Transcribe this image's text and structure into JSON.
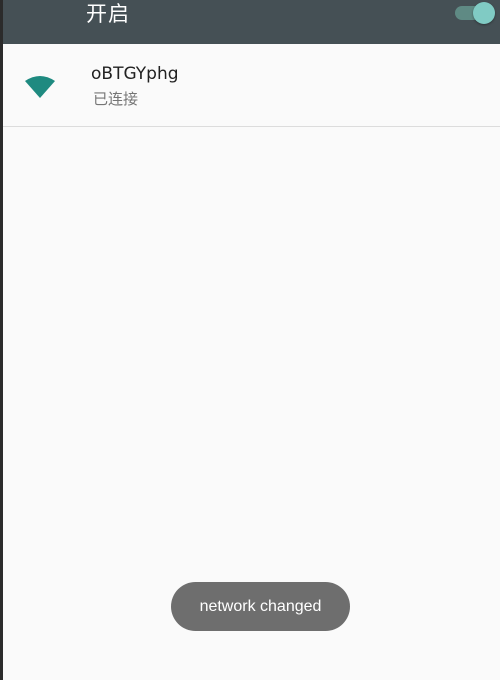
{
  "header": {
    "title": "开启",
    "wifi_toggle_on": true,
    "accent_color": "#80cbc4",
    "bar_color": "#455055"
  },
  "network": {
    "ssid": "oBTGYphg",
    "status": "已连接",
    "icon": "wifi-signal-icon",
    "icon_color": "#1e8a80"
  },
  "toast": {
    "message": "network changed"
  }
}
